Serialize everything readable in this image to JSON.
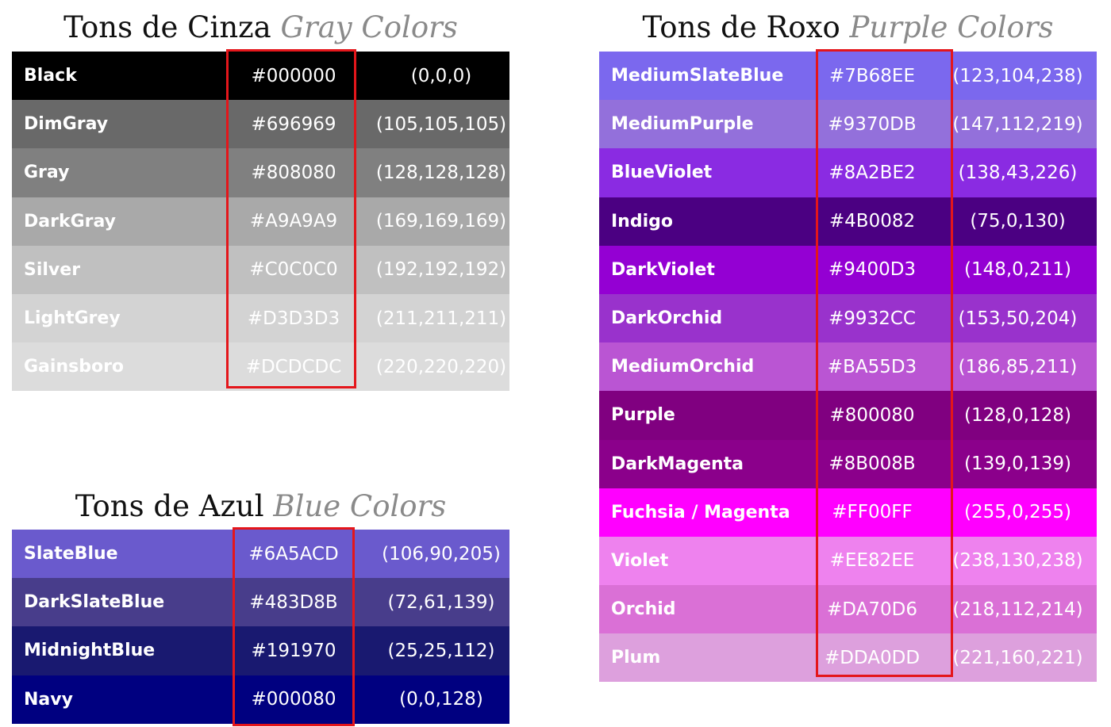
{
  "gray": {
    "title": "Tons de Cinza",
    "subtitle": "Gray Colors",
    "rows": [
      {
        "name": "Black",
        "hex": "#000000",
        "rgb": "(0,0,0)",
        "bg": "#000000",
        "fg": "#ffffff"
      },
      {
        "name": "DimGray",
        "hex": "#696969",
        "rgb": "(105,105,105)",
        "bg": "#696969",
        "fg": "#ffffff"
      },
      {
        "name": "Gray",
        "hex": "#808080",
        "rgb": "(128,128,128)",
        "bg": "#808080",
        "fg": "#ffffff"
      },
      {
        "name": "DarkGray",
        "hex": "#A9A9A9",
        "rgb": "(169,169,169)",
        "bg": "#A9A9A9",
        "fg": "#ffffff"
      },
      {
        "name": "Silver",
        "hex": "#C0C0C0",
        "rgb": "(192,192,192)",
        "bg": "#C0C0C0",
        "fg": "#ffffff"
      },
      {
        "name": "LightGrey",
        "hex": "#D3D3D3",
        "rgb": "(211,211,211)",
        "bg": "#D3D3D3",
        "fg": "#ffffff"
      },
      {
        "name": "Gainsboro",
        "hex": "#DCDCDC",
        "rgb": "(220,220,220)",
        "bg": "#DCDCDC",
        "fg": "#ffffff"
      }
    ]
  },
  "blue": {
    "title": "Tons de Azul",
    "subtitle": "Blue Colors",
    "rows": [
      {
        "name": "SlateBlue",
        "hex": "#6A5ACD",
        "rgb": "(106,90,205)",
        "bg": "#6A5ACD",
        "fg": "#ffffff"
      },
      {
        "name": "DarkSlateBlue",
        "hex": "#483D8B",
        "rgb": "(72,61,139)",
        "bg": "#483D8B",
        "fg": "#ffffff"
      },
      {
        "name": "MidnightBlue",
        "hex": "#191970",
        "rgb": "(25,25,112)",
        "bg": "#191970",
        "fg": "#ffffff"
      },
      {
        "name": "Navy",
        "hex": "#000080",
        "rgb": "(0,0,128)",
        "bg": "#000080",
        "fg": "#ffffff"
      }
    ]
  },
  "purple": {
    "title": "Tons de Roxo",
    "subtitle": "Purple Colors",
    "rows": [
      {
        "name": "MediumSlateBlue",
        "hex": "#7B68EE",
        "rgb": "(123,104,238)",
        "bg": "#7B68EE",
        "fg": "#ffffff"
      },
      {
        "name": "MediumPurple",
        "hex": "#9370DB",
        "rgb": "(147,112,219)",
        "bg": "#9370DB",
        "fg": "#ffffff"
      },
      {
        "name": "BlueViolet",
        "hex": "#8A2BE2",
        "rgb": "(138,43,226)",
        "bg": "#8A2BE2",
        "fg": "#ffffff"
      },
      {
        "name": "Indigo",
        "hex": "#4B0082",
        "rgb": "(75,0,130)",
        "bg": "#4B0082",
        "fg": "#ffffff"
      },
      {
        "name": "DarkViolet",
        "hex": "#9400D3",
        "rgb": "(148,0,211)",
        "bg": "#9400D3",
        "fg": "#ffffff"
      },
      {
        "name": "DarkOrchid",
        "hex": "#9932CC",
        "rgb": "(153,50,204)",
        "bg": "#9932CC",
        "fg": "#ffffff"
      },
      {
        "name": "MediumOrchid",
        "hex": "#BA55D3",
        "rgb": "(186,85,211)",
        "bg": "#BA55D3",
        "fg": "#ffffff"
      },
      {
        "name": "Purple",
        "hex": "#800080",
        "rgb": "(128,0,128)",
        "bg": "#800080",
        "fg": "#ffffff"
      },
      {
        "name": "DarkMagenta",
        "hex": "#8B008B",
        "rgb": "(139,0,139)",
        "bg": "#8B008B",
        "fg": "#ffffff"
      },
      {
        "name": "Fuchsia / Magenta",
        "hex": "#FF00FF",
        "rgb": "(255,0,255)",
        "bg": "#FF00FF",
        "fg": "#ffffff"
      },
      {
        "name": "Violet",
        "hex": "#EE82EE",
        "rgb": "(238,130,238)",
        "bg": "#EE82EE",
        "fg": "#ffffff"
      },
      {
        "name": "Orchid",
        "hex": "#DA70D6",
        "rgb": "(218,112,214)",
        "bg": "#DA70D6",
        "fg": "#ffffff"
      },
      {
        "name": "Plum",
        "hex": "#DDA0DD",
        "rgb": "(221,160,221)",
        "bg": "#DDA0DD",
        "fg": "#ffffff"
      }
    ]
  },
  "highlight_color": "#e4161b"
}
